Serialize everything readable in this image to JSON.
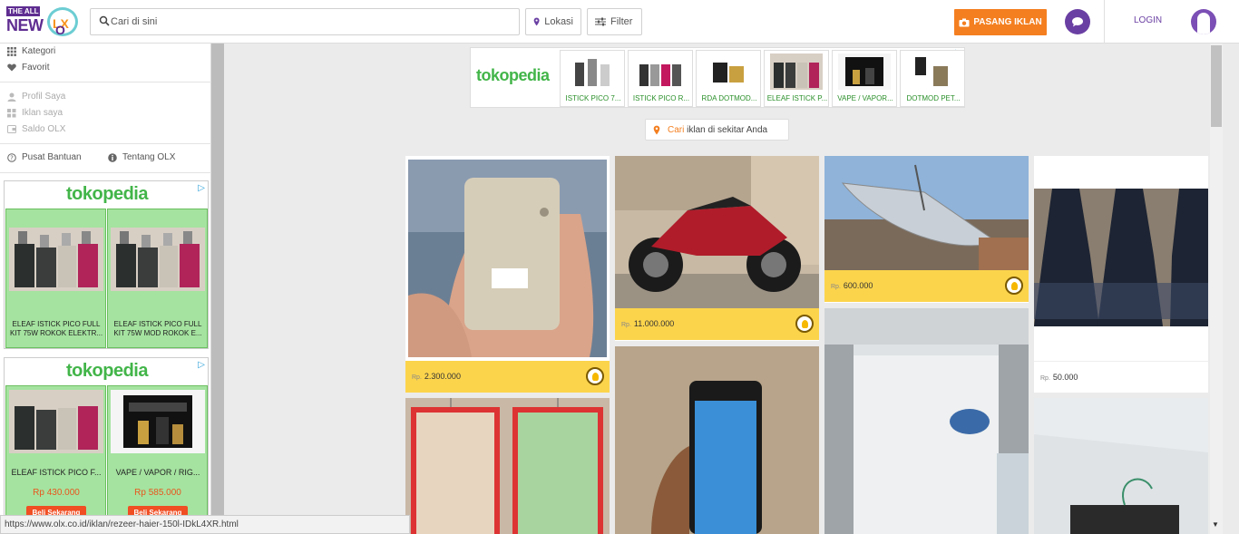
{
  "header": {
    "logo_top": "THE ALL",
    "logo_bottom": "NEW",
    "logo_olx_o": "O",
    "logo_olx_lx": "LX",
    "search_placeholder": "Cari di sini",
    "lokasi_label": "Lokasi",
    "filter_label": "Filter",
    "pasang_label": "PASANG IKLAN",
    "login_label": "LOGIN"
  },
  "sidebar": {
    "nav": [
      {
        "label": "Kategori",
        "icon": "grid-icon"
      },
      {
        "label": "Favorit",
        "icon": "heart-icon"
      }
    ],
    "account": [
      {
        "label": "Profil Saya",
        "icon": "user-icon"
      },
      {
        "label": "Iklan saya",
        "icon": "grid-icon"
      },
      {
        "label": "Saldo OLX",
        "icon": "wallet-icon"
      }
    ],
    "help": {
      "pusat": "Pusat Bantuan",
      "tentang": "Tentang OLX"
    },
    "ads": [
      {
        "brand": "tokopedia",
        "items": [
          {
            "caption": "ELEAF ISTICK PICO FULL KIT 75W ROKOK ELEKTR..."
          },
          {
            "caption": "ELEAF ISTICK PICO FULL KIT 75W MOD ROKOK E..."
          }
        ]
      },
      {
        "brand": "tokopedia",
        "items": [
          {
            "caption": "ELEAF ISTICK PICO F...",
            "price": "Rp 430.000",
            "button": "Beli Sekarang"
          },
          {
            "caption": "VAPE / VAPOR / RIG...",
            "price": "Rp 585.000",
            "button": "Beli Sekarang"
          }
        ]
      }
    ]
  },
  "topad": {
    "brand": "tokopedia",
    "products": [
      "ISTICK PICO 7...",
      "ISTICK PICO R...",
      "RDA DOTMOD...",
      "ELEAF ISTICK P...",
      "VAPE / VAPOR...",
      "DOTMOD PET..."
    ]
  },
  "cari": {
    "highlight": "Cari",
    "rest": "iklan di sekitar Anda"
  },
  "listings": [
    {
      "currency": "Rp.",
      "price": "2.300.000"
    },
    {
      "currency": "Rp.",
      "price": "11.000.000"
    },
    {
      "currency": "Rp.",
      "price": "600.000"
    },
    {
      "currency": "Rp.",
      "price": "50.000"
    }
  ],
  "status_url": "https://www.olx.co.id/iklan/rezeer-haier-150l-IDkL4XR.html",
  "colors": {
    "brand_purple": "#5f2d91",
    "accent_orange": "#f47f20",
    "price_yellow": "#fcd44c",
    "tokopedia_green": "#42b549"
  }
}
